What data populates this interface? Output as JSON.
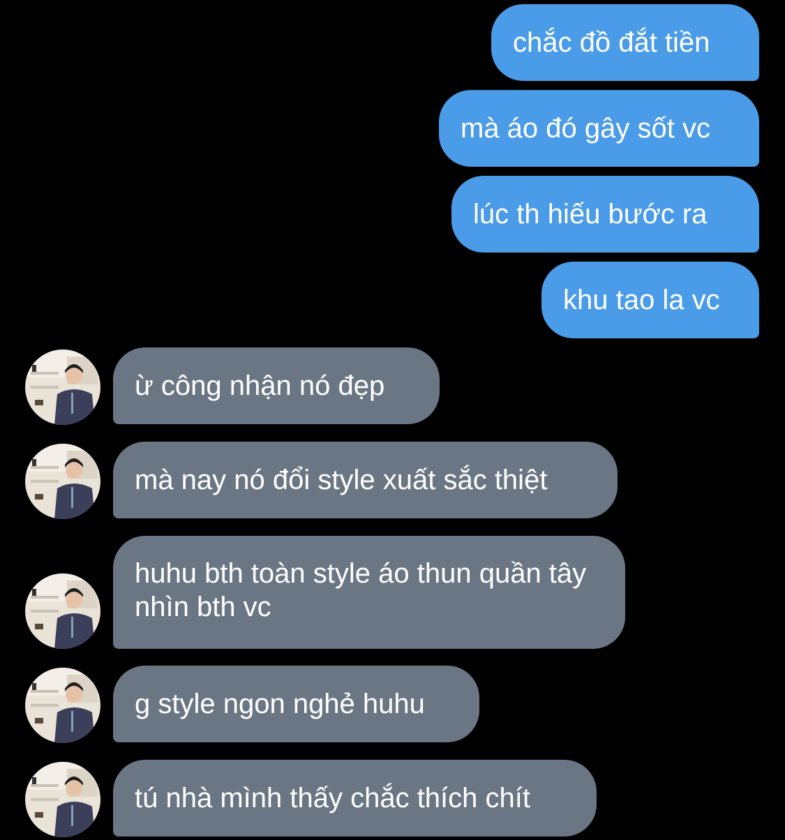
{
  "colors": {
    "background": "#000000",
    "outgoing_bubble": "#4a9be8",
    "incoming_bubble": "#6b7685",
    "bubble_text": "#ffffff"
  },
  "messages": [
    {
      "direction": "outgoing",
      "text": "chắc đồ đắt tiền"
    },
    {
      "direction": "outgoing",
      "text": "mà áo đó gây sốt vc"
    },
    {
      "direction": "outgoing",
      "text": "lúc th hiếu bước ra"
    },
    {
      "direction": "outgoing",
      "text": "khu tao la vc"
    },
    {
      "direction": "incoming",
      "text": "ừ công nhận nó đẹp",
      "avatar": "contact-avatar"
    },
    {
      "direction": "incoming",
      "text": "mà nay nó đổi style xuất sắc thiệt",
      "avatar": "contact-avatar"
    },
    {
      "direction": "incoming",
      "text": "huhu bth toàn style áo thun quần tây nhìn bth vc",
      "avatar": "contact-avatar"
    },
    {
      "direction": "incoming",
      "text": "g style ngon nghẻ huhu",
      "avatar": "contact-avatar"
    },
    {
      "direction": "incoming",
      "text": "tú nhà mình thấy chắc thích chít",
      "avatar": "contact-avatar"
    }
  ]
}
